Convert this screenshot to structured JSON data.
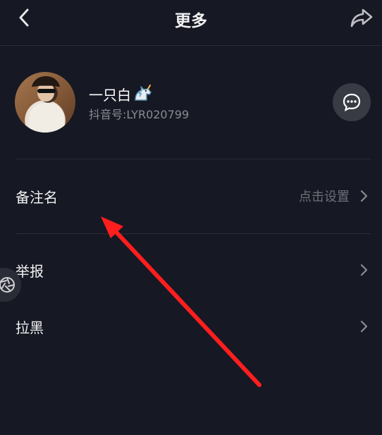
{
  "header": {
    "title": "更多"
  },
  "profile": {
    "name": "一只白",
    "account_id": "抖音号:LYR020799"
  },
  "menu": [
    {
      "label": "备注名",
      "hint": "点击设置"
    },
    {
      "label": "举报"
    },
    {
      "label": "拉黑"
    }
  ],
  "colors": {
    "background": "#161823",
    "annotation_arrow": "#ff1e1e",
    "secondary_text": "#8a8b91"
  },
  "icons": [
    "back-icon",
    "share-icon",
    "unicorn-icon",
    "message-icon",
    "chevron-right-icon",
    "aperture-icon"
  ]
}
